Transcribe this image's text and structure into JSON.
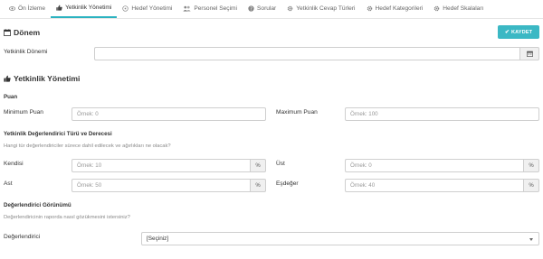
{
  "tabs": [
    {
      "label": "Ön İzleme",
      "icon": "eye-icon"
    },
    {
      "label": "Yetkinlik Yönetimi",
      "icon": "thumbs-up-icon"
    },
    {
      "label": "Hedef Yönetimi",
      "icon": "crosshair-icon"
    },
    {
      "label": "Personel Seçimi",
      "icon": "users-icon"
    },
    {
      "label": "Sorular",
      "icon": "question-icon"
    },
    {
      "label": "Yetkinlik Cevap Türleri",
      "icon": "gear-icon"
    },
    {
      "label": "Hedef Kategorileri",
      "icon": "gear-icon"
    },
    {
      "label": "Hedef Skalaları",
      "icon": "gear-icon"
    }
  ],
  "active_tab": "Yetkinlik Yönetimi",
  "donem": {
    "title": "Dönem",
    "save_label": "KAYDET",
    "field_label": "Yetkinlik Dönemi",
    "field_value": ""
  },
  "yetkinlik": {
    "title": "Yetkinlik Yönetimi",
    "puan": {
      "heading": "Puan",
      "min_label": "Minimum Puan",
      "min_placeholder": "Örnek: 0",
      "max_label": "Maximum Puan",
      "max_placeholder": "Örnek: 100"
    },
    "degerlendirici": {
      "heading": "Yetkinlik Değerlendirici Türü ve Derecesi",
      "hint": "Hangi tür değerlendiriciler sürece dahil edilecek ve ağırlıkları ne olacak?",
      "kendisi_label": "Kendisi",
      "kendisi_placeholder": "Örnek: 10",
      "ust_label": "Üst",
      "ust_placeholder": "Örnek: 0",
      "ast_label": "Ast",
      "ast_placeholder": "Örnek: 50",
      "esdeger_label": "Eşdeğer",
      "esdeger_placeholder": "Örnek: 40",
      "percent_sign": "%"
    },
    "gorunum": {
      "heading": "Değerlendirici Görünümü",
      "hint": "Değerlendiricinin raporda nasıl gözükmesini istersiniz?",
      "label": "Değerlendirici",
      "selected": "[Seçiniz]"
    }
  },
  "colors": {
    "accent": "#3bb8c4",
    "active_tab_underline": "#2bb3c0"
  }
}
